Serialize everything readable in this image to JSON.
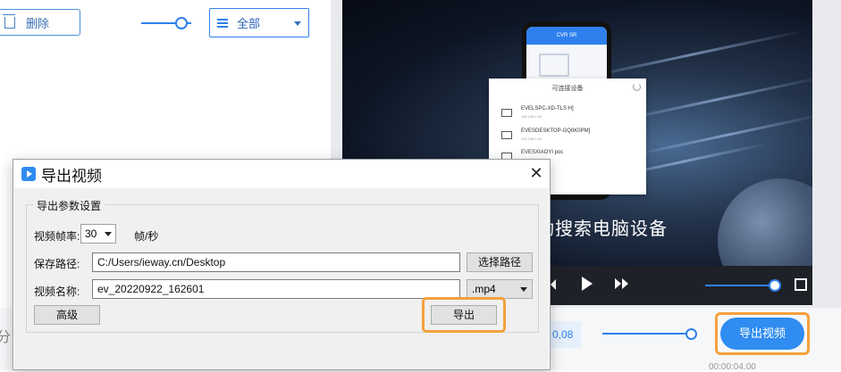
{
  "toolbar": {
    "delete_label": "删除",
    "filter_value": "全部"
  },
  "video": {
    "phone_header": "CVR SR",
    "popup_title": "可连接设备",
    "devices": [
      {
        "name": "EVELSPC-XD-TLS H]",
        "sub": "192.168.1.25"
      },
      {
        "name": "EVESDESKTOP-GQ0K0PM]",
        "sub": "192.168.1.42"
      },
      {
        "name": "EVESXIAOYI poc",
        "sub": ""
      }
    ],
    "caption": "动搜索电脑设备"
  },
  "bottom": {
    "time_chip": "0,08",
    "export_video_label": "导出视频",
    "time_readout": "00:00:04.00",
    "left_fragment": "分"
  },
  "dialog": {
    "title": "导出视频",
    "close_glyph": "✕",
    "group_title": "导出参数设置",
    "fps_label": "视频帧率:",
    "fps_value": "30",
    "fps_unit": "帧/秒",
    "path_label": "保存路径:",
    "path_value": "C:/Users/ieway.cn/Desktop",
    "choose_path_label": "选择路径",
    "name_label": "视频名称:",
    "name_value": "ev_20220922_162601",
    "format_value": ".mp4",
    "advanced_label": "高级",
    "export_label": "导出"
  },
  "colors": {
    "accent": "#2f8cf0",
    "highlight": "#f5a13c"
  }
}
